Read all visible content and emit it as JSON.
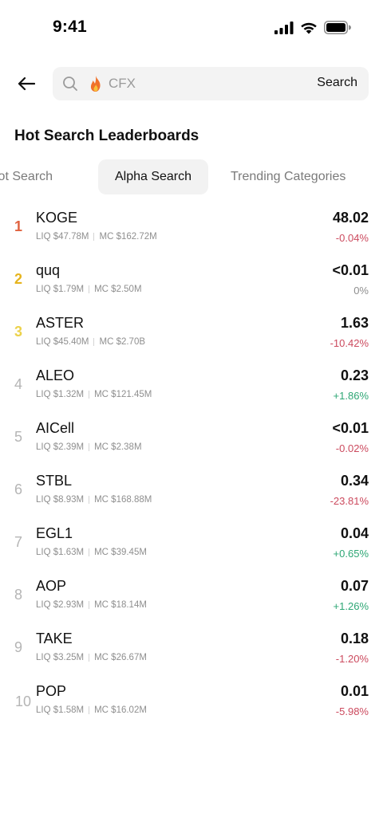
{
  "status_bar": {
    "time": "9:41"
  },
  "search": {
    "placeholder": "CFX",
    "button_label": "Search"
  },
  "section_title": "Hot Search Leaderboards",
  "tabs": [
    {
      "label": "Hot Search"
    },
    {
      "label": "Alpha Search"
    },
    {
      "label": "Trending Categories"
    }
  ],
  "colors": {
    "rank_1": "#e0623f",
    "rank_2": "#e6b41e",
    "rank_3": "#ecd24b",
    "rank_default": "#b5b5b5",
    "negative": "#cc4a5e",
    "positive": "#2ea775",
    "neutral": "#8f8f8f"
  },
  "rows": [
    {
      "rank": "1",
      "symbol": "KOGE",
      "liq": "LIQ $47.78M",
      "mc": "MC $162.72M",
      "price": "48.02",
      "change": "-0.04%",
      "trend": "negative"
    },
    {
      "rank": "2",
      "symbol": "quq",
      "liq": "LIQ $1.79M",
      "mc": "MC $2.50M",
      "price": "<0.01",
      "change": "0%",
      "trend": "neutral"
    },
    {
      "rank": "3",
      "symbol": "ASTER",
      "liq": "LIQ $45.40M",
      "mc": "MC $2.70B",
      "price": "1.63",
      "change": "-10.42%",
      "trend": "negative"
    },
    {
      "rank": "4",
      "symbol": "ALEO",
      "liq": "LIQ $1.32M",
      "mc": "MC $121.45M",
      "price": "0.23",
      "change": "+1.86%",
      "trend": "positive"
    },
    {
      "rank": "5",
      "symbol": "AICell",
      "liq": "LIQ $2.39M",
      "mc": "MC $2.38M",
      "price": "<0.01",
      "change": "-0.02%",
      "trend": "negative"
    },
    {
      "rank": "6",
      "symbol": "STBL",
      "liq": "LIQ $8.93M",
      "mc": "MC $168.88M",
      "price": "0.34",
      "change": "-23.81%",
      "trend": "negative"
    },
    {
      "rank": "7",
      "symbol": "EGL1",
      "liq": "LIQ $1.63M",
      "mc": "MC $39.45M",
      "price": "0.04",
      "change": "+0.65%",
      "trend": "positive"
    },
    {
      "rank": "8",
      "symbol": "AOP",
      "liq": "LIQ $2.93M",
      "mc": "MC $18.14M",
      "price": "0.07",
      "change": "+1.26%",
      "trend": "positive"
    },
    {
      "rank": "9",
      "symbol": "TAKE",
      "liq": "LIQ $3.25M",
      "mc": "MC $26.67M",
      "price": "0.18",
      "change": "-1.20%",
      "trend": "negative"
    },
    {
      "rank": "10",
      "symbol": "POP",
      "liq": "LIQ $1.58M",
      "mc": "MC $16.02M",
      "price": "0.01",
      "change": "-5.98%",
      "trend": "negative"
    }
  ]
}
